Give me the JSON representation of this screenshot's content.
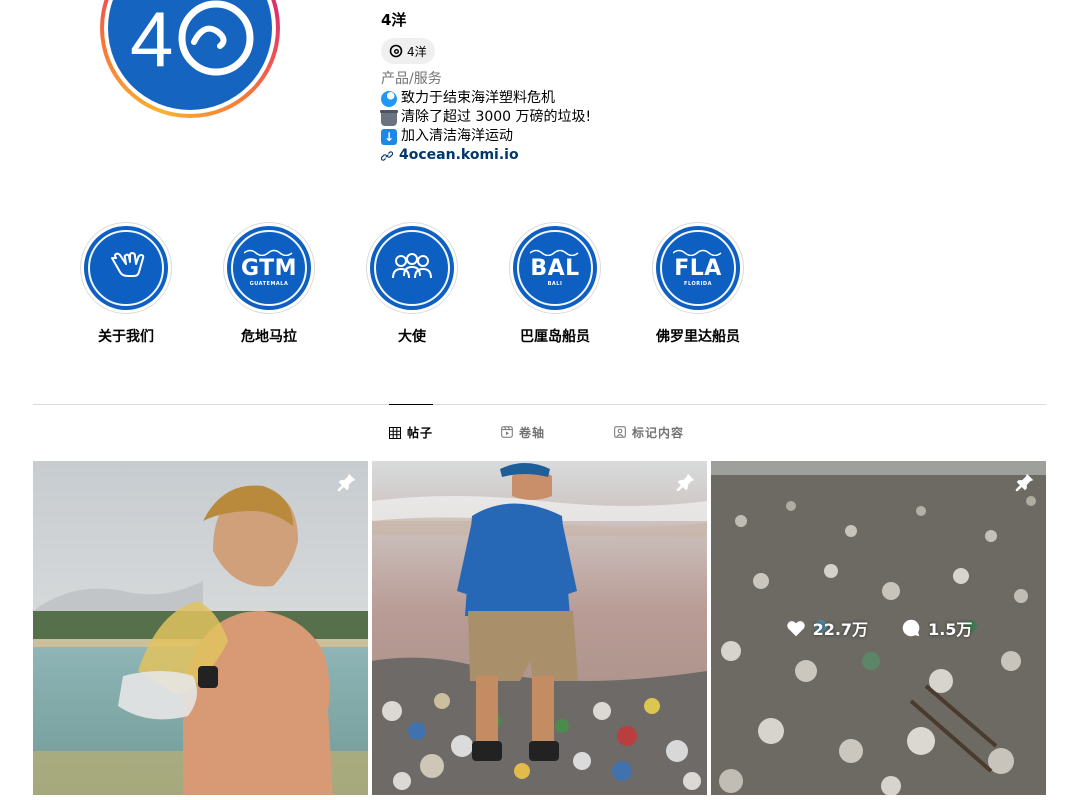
{
  "profile": {
    "username": "4洋",
    "threads_label": "4洋",
    "category": "产品/服务",
    "bio": [
      {
        "icon": "wave-emoji-icon",
        "text": "致力于结束海洋塑料危机"
      },
      {
        "icon": "wastebasket-emoji-icon",
        "text": "清除了超过 3000 万磅的垃圾!"
      },
      {
        "icon": "down-arrow-emoji-icon",
        "text": "加入清洁海洋运动"
      }
    ],
    "link": "4ocean.komi.io",
    "avatar_text": "4",
    "brand_color": "#1565c0"
  },
  "highlights": [
    {
      "label": "关于我们",
      "icon": "shaka-hand-icon"
    },
    {
      "label": "危地马拉",
      "code": "GTM",
      "sub": "GUATEMALA"
    },
    {
      "label": "大使",
      "icon": "people-group-icon"
    },
    {
      "label": "巴厘岛船员",
      "code": "BAL",
      "sub": "BALI"
    },
    {
      "label": "佛罗里达船员",
      "code": "FLA",
      "sub": "FLORIDA"
    }
  ],
  "tabs": [
    {
      "label": "帖子",
      "icon": "grid-icon",
      "active": true
    },
    {
      "label": "卷轴",
      "icon": "reels-icon",
      "active": false
    },
    {
      "label": "标记内容",
      "icon": "tagged-icon",
      "active": false
    }
  ],
  "posts": [
    {
      "pinned": true
    },
    {
      "pinned": true
    },
    {
      "pinned": true,
      "likes": "22.7万",
      "comments": "1.5万"
    }
  ]
}
